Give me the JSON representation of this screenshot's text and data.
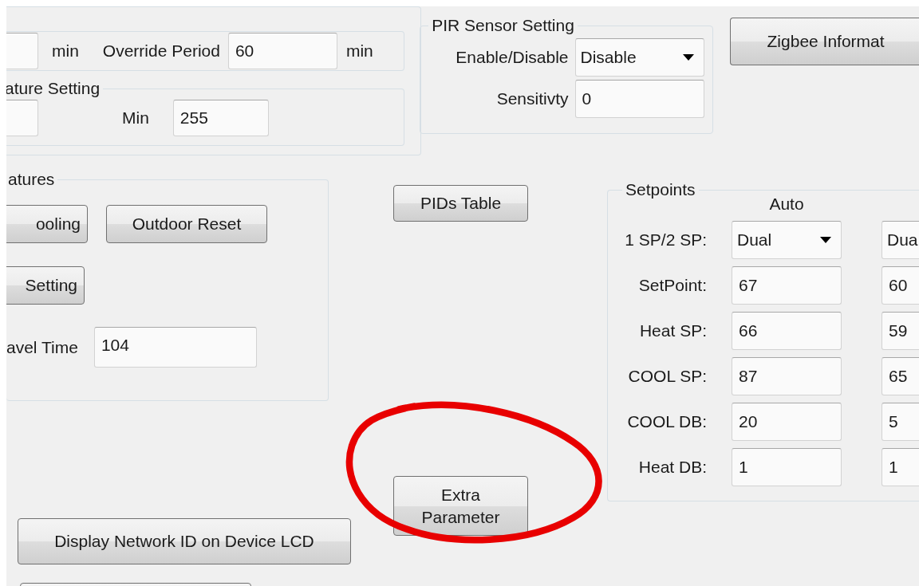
{
  "schedule_group": {
    "items": [
      {
        "kind": "field"
      },
      {
        "kind": "label",
        "text": "min"
      },
      {
        "kind": "label",
        "text": "Override Period"
      },
      {
        "kind": "field",
        "value": "60"
      },
      {
        "kind": "label",
        "text": "min"
      }
    ]
  },
  "temperature_group": {
    "title": "ature Setting",
    "items": [
      {
        "kind": "field"
      },
      {
        "kind": "label",
        "text": "Min"
      },
      {
        "kind": "field",
        "value": "255"
      }
    ]
  },
  "pir_group": {
    "title": "PIR Sensor Setting",
    "rows": [
      {
        "label": "Enable/Disable",
        "kind": "dropdown",
        "value": "Disable"
      },
      {
        "label": "Sensitivty",
        "kind": "field",
        "value": "0"
      }
    ]
  },
  "zigbee_button": "Zigbee Informat",
  "features_group": {
    "title": "atures",
    "buttons": [
      "ooling",
      "Outdoor Reset",
      "Setting"
    ],
    "travel_time": {
      "label": "avel Time",
      "value": "104"
    }
  },
  "pids_button": "PIDs Table",
  "extra_button": "Extra Parameter",
  "display_button": "Display Network ID on Device LCD",
  "setpoints": {
    "title": "Setpoints",
    "columns": [
      "Auto"
    ],
    "rows": [
      {
        "label": "1 SP/2 SP:",
        "kind": "dropdown",
        "values": [
          "Dual",
          "Dua"
        ]
      },
      {
        "label": "SetPoint:",
        "kind": "field",
        "values": [
          "67",
          "60"
        ]
      },
      {
        "label": "Heat SP:",
        "kind": "field",
        "values": [
          "66",
          "59"
        ]
      },
      {
        "label": "COOL SP:",
        "kind": "field",
        "values": [
          "87",
          "65"
        ]
      },
      {
        "label": "COOL DB:",
        "kind": "field",
        "values": [
          "20",
          "5"
        ]
      },
      {
        "label": "Heat DB:",
        "kind": "field",
        "values": [
          "1",
          "1"
        ]
      }
    ]
  },
  "annotation": {
    "kind": "ellipse"
  }
}
